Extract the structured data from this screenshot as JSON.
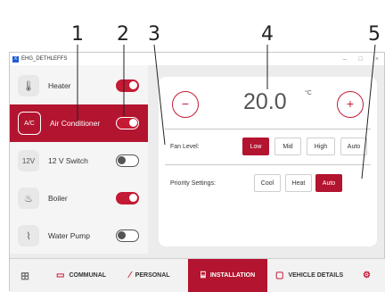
{
  "window": {
    "title": "EHG_DETHLEFFS",
    "controls": [
      "–",
      "□",
      "×"
    ]
  },
  "callouts": [
    "1",
    "2",
    "3",
    "4",
    "5"
  ],
  "sidebar": {
    "items": [
      {
        "label": "Heater",
        "icon": "thermometer-icon",
        "glyph": "🌡",
        "state": "on"
      },
      {
        "label": "Air Conditioner",
        "icon": "ac-icon",
        "glyph": "A/C",
        "state": "on",
        "active": true
      },
      {
        "label": "12 V Switch",
        "icon": "12v-icon",
        "glyph": "12V",
        "state": "off"
      },
      {
        "label": "Boiler",
        "icon": "flame-icon",
        "glyph": "♨",
        "state": "on"
      },
      {
        "label": "Water Pump",
        "icon": "water-pump-icon",
        "glyph": "⌇",
        "state": "off"
      }
    ]
  },
  "climate": {
    "minus": "−",
    "plus": "+",
    "temperature": "20.0",
    "unit": "°C",
    "fan_label": "Fan Level:",
    "fan_options": [
      "Low",
      "Mid",
      "High",
      "Auto"
    ],
    "fan_selected": "Low",
    "priority_label": "Priority Settings:",
    "priority_options": [
      "Cool",
      "Heat",
      "Auto"
    ],
    "priority_selected": "Auto"
  },
  "nav": {
    "home_glyph": "⊞",
    "items": [
      {
        "label": "COMMUNAL",
        "icon": "communal-icon",
        "glyph": "▭"
      },
      {
        "label": "PERSONAL",
        "icon": "personal-icon",
        "glyph": "⁄"
      },
      {
        "label": "INSTALLATION",
        "icon": "installation-icon",
        "glyph": "⌸",
        "active": true
      },
      {
        "label": "VEHICLE DETAILS",
        "icon": "vehicle-icon",
        "glyph": "▢"
      }
    ],
    "settings_glyph": "⚙"
  },
  "colors": {
    "accent": "#b3142f",
    "toggle_on": "#c41a34"
  }
}
